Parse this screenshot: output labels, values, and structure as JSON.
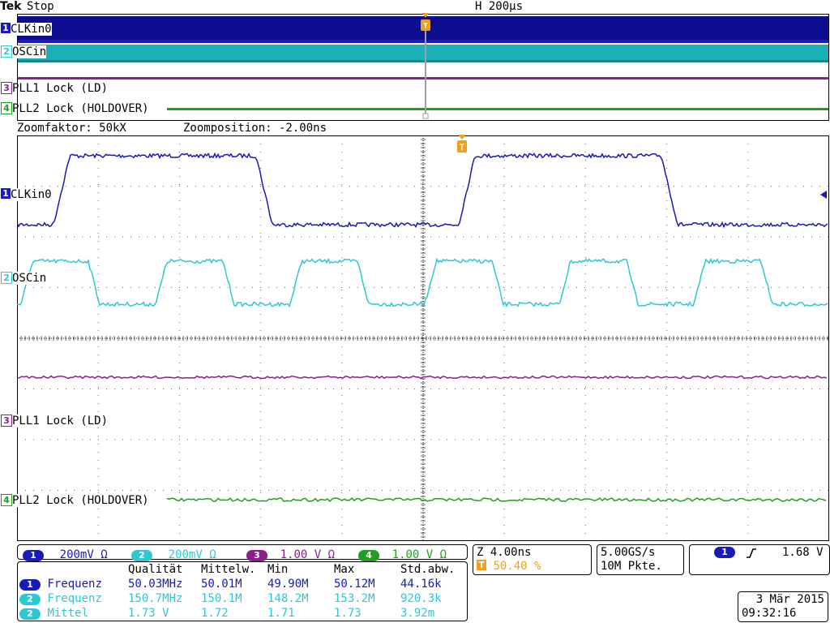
{
  "header": {
    "brand": "Tek",
    "run_state": "Stop",
    "timebase": "H 200µs"
  },
  "colors": {
    "ch1": "#1a1ab4",
    "ch2": "#2ec8d2",
    "ch3": "#8a1e8a",
    "ch4": "#1ea01e",
    "trigger": "#f0a020"
  },
  "overview": {
    "channels": [
      {
        "num": "1",
        "label": "CLKin0"
      },
      {
        "num": "2",
        "label": "OSCin"
      },
      {
        "num": "3",
        "label": "PLL1 Lock (LD)"
      },
      {
        "num": "4",
        "label": "PLL2 Lock (HOLDOVER)"
      }
    ]
  },
  "zoom": {
    "factor": "Zoomfaktor: 50kX",
    "position": "Zoomposition: -2.00ns"
  },
  "main": {
    "channels": [
      {
        "num": "1",
        "label": "CLKin0"
      },
      {
        "num": "2",
        "label": "OSCin"
      },
      {
        "num": "3",
        "label": "PLL1 Lock (LD)"
      },
      {
        "num": "4",
        "label": "PLL2 Lock (HOLDOVER)"
      }
    ],
    "trigger_marker": "T"
  },
  "vertical": [
    {
      "num": "1",
      "value": "200mV Ω"
    },
    {
      "num": "2",
      "value": "200mV Ω"
    },
    {
      "num": "3",
      "value": "1.00 V Ω"
    },
    {
      "num": "4",
      "value": "1.00 V Ω"
    }
  ],
  "horizontal": {
    "zoom_scale": "Z 4.00ns",
    "trigger_pos": "50.40 %",
    "sample_rate": "5.00GS/s",
    "record_length": "10M Pkte."
  },
  "trigger": {
    "source": "1",
    "slope_icon": "rising-edge",
    "level": "1.68 V"
  },
  "measurements": {
    "headers": [
      "",
      "Qualität",
      "Mittelw.",
      "Min",
      "Max",
      "Std.abw."
    ],
    "rows": [
      {
        "ch": "1",
        "name": "Frequenz",
        "value": "50.03MHz",
        "mean": "50.01M",
        "min": "49.90M",
        "max": "50.12M",
        "std": "44.16k"
      },
      {
        "ch": "2",
        "name": "Frequenz",
        "value": "150.7MHz",
        "mean": "150.1M",
        "min": "148.2M",
        "max": "153.2M",
        "std": "920.3k"
      },
      {
        "ch": "2",
        "name": "Mittel",
        "value": "1.73 V",
        "mean": "1.72",
        "min": "1.71",
        "max": "1.73",
        "std": "3.92m"
      }
    ]
  },
  "datetime": {
    "date": "3 Mär 2015",
    "time": "09:32:16"
  }
}
